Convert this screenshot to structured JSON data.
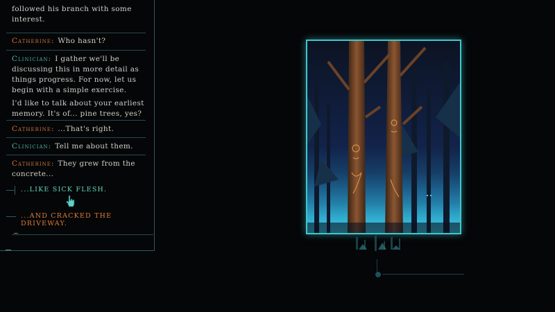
{
  "dialogue": {
    "top_fragment": "followed his branch with some interest.",
    "entries": [
      {
        "speaker": "Catherine",
        "role": "cath",
        "text": "Who hasn't?"
      },
      {
        "speaker": "Clinician",
        "role": "clin",
        "text": "I gather we'll be discussing this in more detail as things progress. For now, let us begin with a simple exercise."
      },
      {
        "speaker": "",
        "role": "clin",
        "text": "I'd like to talk about your earliest memory. It's of... pine trees, yes?"
      },
      {
        "speaker": "Catherine",
        "role": "cath",
        "text": "...That's right."
      },
      {
        "speaker": "Clinician",
        "role": "clin",
        "text": "Tell me about them."
      },
      {
        "speaker": "Catherine",
        "role": "cath",
        "text": "They grew from the concrete..."
      }
    ],
    "options": [
      {
        "label": "...like sick flesh.",
        "state": "hovered"
      },
      {
        "label": "...and cracked the driveway.",
        "state": "normal"
      }
    ]
  },
  "painting": {
    "subject": "pine-forest-memory",
    "frame_color": "#3fc7cf"
  },
  "colors": {
    "catherine": "#d0733b",
    "clinician": "#4fb6a6",
    "option_hover": "#63d6b8",
    "option": "#e07e35"
  }
}
